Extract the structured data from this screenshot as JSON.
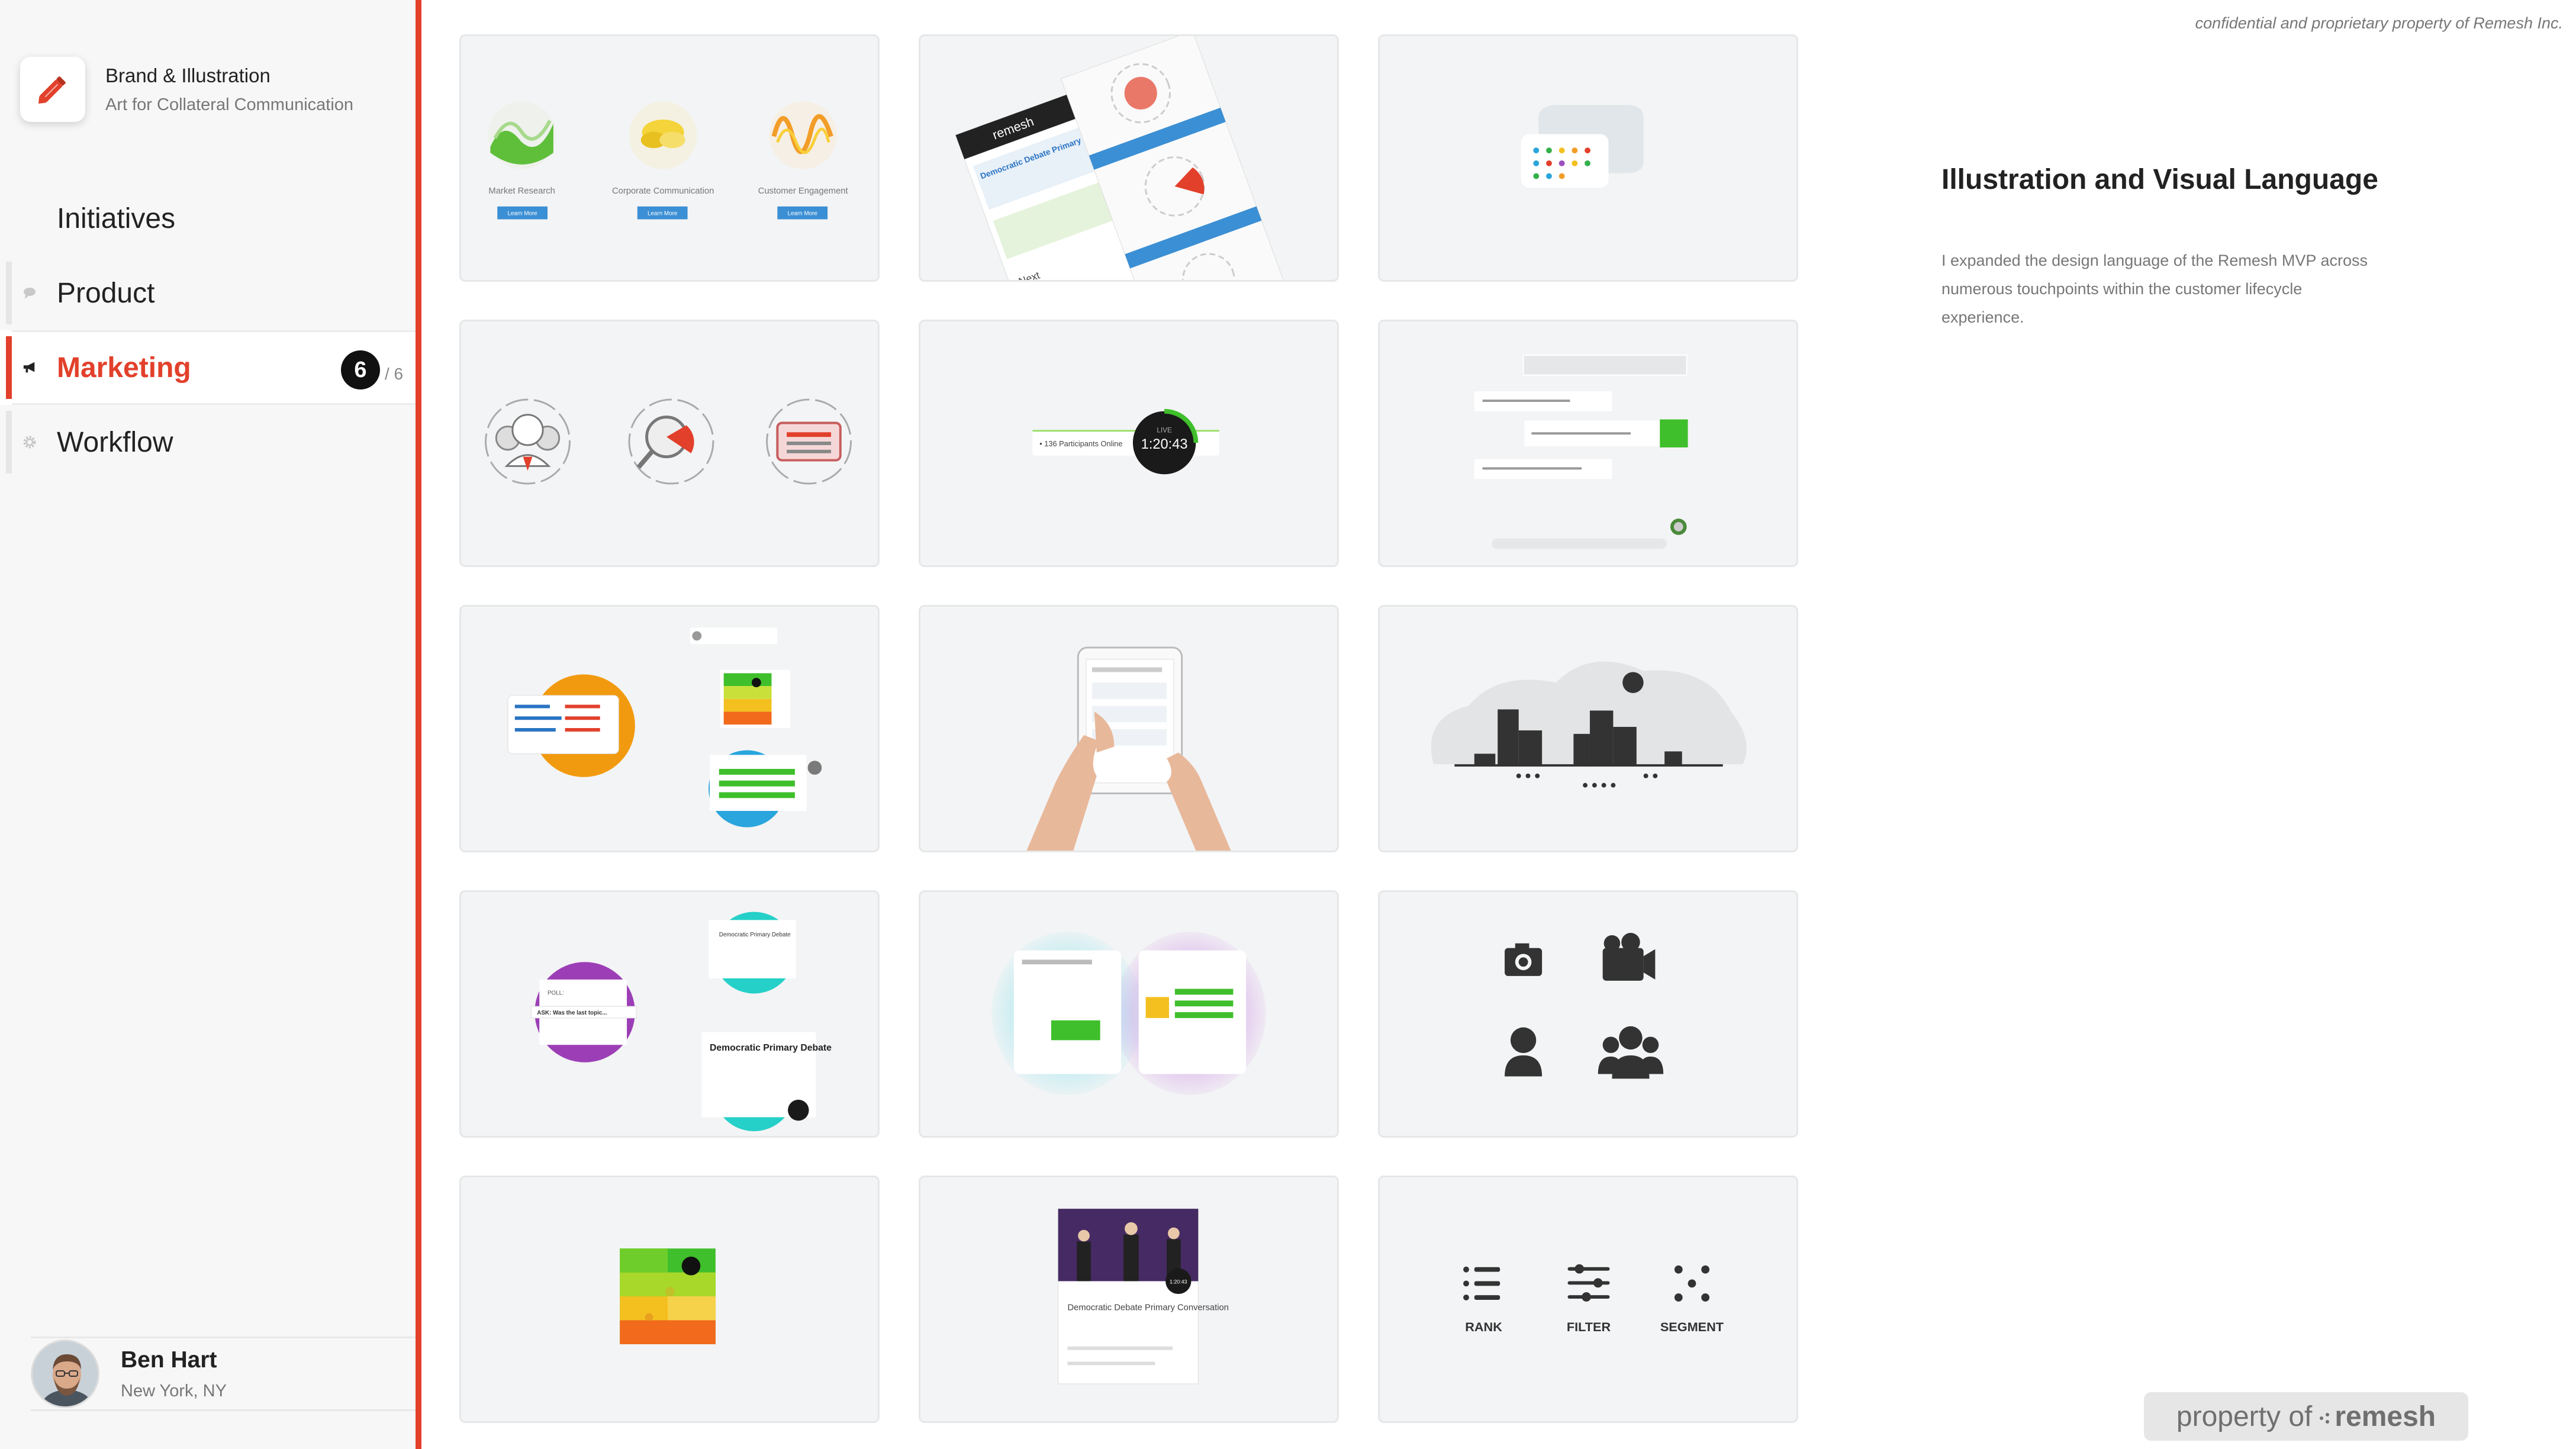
{
  "project": {
    "title": "Brand & Illustration",
    "subtitle": "Art for Collateral Communication",
    "icon": "pencil-icon",
    "accent": "#e2402b"
  },
  "nav": {
    "items": [
      {
        "label": "Initiatives",
        "icon": ""
      },
      {
        "label": "Product",
        "icon": "chat-bubble-icon"
      },
      {
        "label": "Marketing",
        "icon": "megaphone-icon",
        "active": true
      },
      {
        "label": "Workflow",
        "icon": "gear-icon"
      }
    ],
    "count": "6",
    "count_total": "/ 6"
  },
  "user": {
    "name": "Ben Hart",
    "location": "New York, NY"
  },
  "tiles": {
    "t1": {
      "labels": [
        "Market Research",
        "Corporate Communication",
        "Customer Engagement"
      ],
      "button": "Learn More"
    },
    "t2": {
      "brand": "remesh",
      "headline": "Democratic Debate Primary Conversation",
      "next": "Next"
    },
    "t5": {
      "participants": "• 136 Participants Online",
      "live": "LIVE",
      "timer": "1:20:43"
    },
    "t10": {
      "card_title": "Democratic Primary Debate",
      "small_title": "Democratic Primary Debate",
      "ask": "ASK: Was the last topic...",
      "poll": "POLL:"
    },
    "t14": {
      "video_title": "Democratic Debate Primary Conversation",
      "timer": "1:20:43"
    },
    "t15": {
      "rank": "RANK",
      "filter": "FILTER",
      "segment": "SEGMENT"
    }
  },
  "panel": {
    "confidential": "confidential and proprietary property of Remesh Inc.",
    "title": "Illustration and Visual Language",
    "body": "I expanded the design language of the Remesh MVP across numerous touchpoints within the customer lifecycle experience."
  },
  "watermark": {
    "prefix": "property of",
    "brand": "remesh"
  }
}
